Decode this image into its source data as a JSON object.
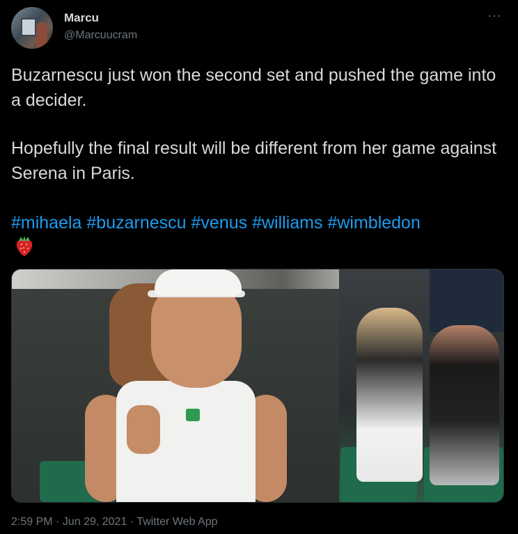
{
  "user": {
    "display_name": "Marcu",
    "handle": "@Marcuucram"
  },
  "tweet": {
    "paragraph1": "Buzarnescu just won the second set and pushed the game into a decider.",
    "paragraph2": "Hopefully the final result will be different from her game against Serena in Paris.",
    "hashtags": [
      "#mihaela",
      "#buzarnescu",
      "#venus",
      "#williams",
      "#wimbledon"
    ],
    "emoji": "strawberry-icon"
  },
  "meta": {
    "time": "2:59 PM",
    "separator": "·",
    "date": "Jun 29, 2021",
    "source": "Twitter Web App"
  },
  "icons": {
    "more": "···"
  },
  "colors": {
    "background": "#000000",
    "text": "#d9d9d9",
    "secondary": "#6e767d",
    "link": "#1d9bf0"
  }
}
